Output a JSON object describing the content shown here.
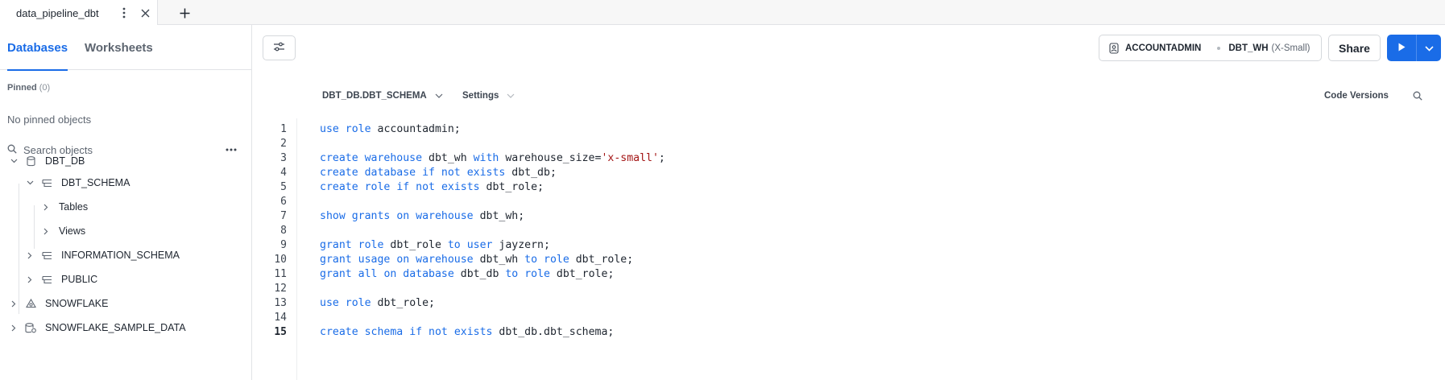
{
  "tab": {
    "title": "data_pipeline_dbt",
    "menu_icon": "kebab-icon",
    "close_icon": "close-icon",
    "add_icon": "plus-icon"
  },
  "sidebar": {
    "tabs": [
      {
        "label": "Databases",
        "active": true
      },
      {
        "label": "Worksheets",
        "active": false
      }
    ],
    "pinned_label": "Pinned",
    "pinned_count": "(0)",
    "no_pinned": "No pinned objects",
    "search_placeholder": "Search objects",
    "tree": [
      {
        "label": "DBT_DB",
        "icon": "database-icon",
        "expanded": true
      },
      {
        "label": "DBT_SCHEMA",
        "icon": "schema-icon",
        "expanded": true
      },
      {
        "label": "Tables",
        "expanded": false
      },
      {
        "label": "Views",
        "expanded": false
      },
      {
        "label": "INFORMATION_SCHEMA",
        "icon": "schema-icon",
        "expanded": false
      },
      {
        "label": "PUBLIC",
        "icon": "schema-icon",
        "expanded": false
      },
      {
        "label": "SNOWFLAKE",
        "icon": "snowflake-app-icon",
        "expanded": false
      },
      {
        "label": "SNOWFLAKE_SAMPLE_DATA",
        "icon": "shared-database-icon",
        "expanded": false
      }
    ]
  },
  "toolbar": {
    "role": "ACCOUNTADMIN",
    "warehouse": "DBT_WH",
    "warehouse_size": "(X-Small)",
    "share_label": "Share",
    "accent": "#1a6ce7"
  },
  "subbar": {
    "context": "DBT_DB.DBT_SCHEMA",
    "settings": "Settings",
    "code_versions": "Code Versions"
  },
  "editor": {
    "current_line": 15,
    "lines": [
      "use role accountadmin;",
      "",
      "create warehouse dbt_wh with warehouse_size='x-small';",
      "create database if not exists dbt_db;",
      "create role if not exists dbt_role;",
      "",
      "show grants on warehouse dbt_wh;",
      "",
      "grant role dbt_role to user jayzern;",
      "grant usage on warehouse dbt_wh to role dbt_role;",
      "grant all on database dbt_db to role dbt_role;",
      "",
      "use role dbt_role;",
      "",
      "create schema if not exists dbt_db.dbt_schema;"
    ]
  }
}
